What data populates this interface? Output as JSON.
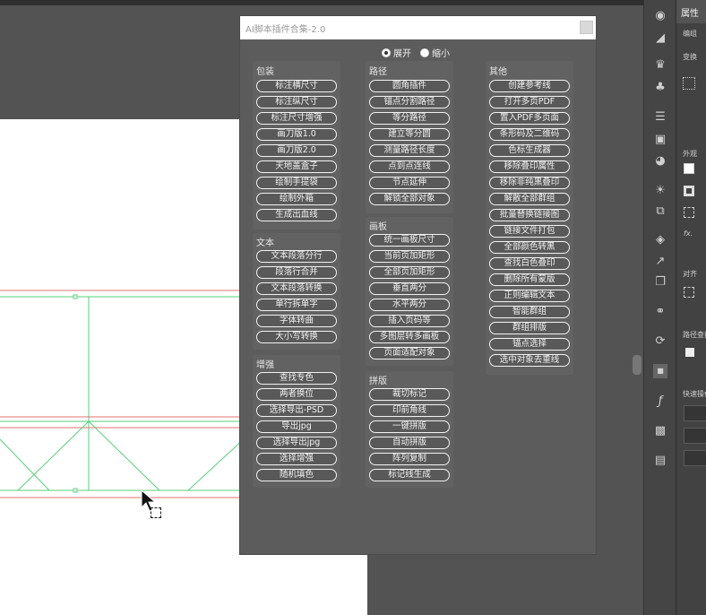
{
  "panel": {
    "title": "AI脚本插件合集-2.0",
    "mode_expand": "展开",
    "mode_collapse": "缩小",
    "groups": {
      "packaging": {
        "title": "包装",
        "buttons": [
          "标注横尺寸",
          "标注纵尺寸",
          "标注尺寸增强",
          "画刀版1.0",
          "画刀版2.0",
          "天地盖盒子",
          "绘制手提袋",
          "绘制外箱",
          "生成出血线"
        ]
      },
      "text": {
        "title": "文本",
        "buttons": [
          "文本段落分行",
          "段落行合并",
          "文本段落转换",
          "单行拆单字",
          "字体转曲",
          "大小写转换"
        ]
      },
      "enhance": {
        "title": "增强",
        "buttons": [
          "查找专色",
          "两者换位",
          "选择导出-PSD",
          "导出jpg",
          "选择导出jpg",
          "选择增强",
          "随机填色"
        ]
      },
      "path": {
        "title": "路径",
        "buttons": [
          "圆角插件",
          "锚点分割路径",
          "等分路径",
          "建立等分圆",
          "测量路径长度",
          "点到点连线",
          "节点延伸",
          "解锁全部对象"
        ]
      },
      "artboard": {
        "title": "画板",
        "buttons": [
          "统一画板尺寸",
          "当前页加矩形",
          "全部页加矩形",
          "垂直两分",
          "水平两分",
          "插入页码等",
          "多图层转多画板",
          "页面适配对象"
        ]
      },
      "imposition": {
        "title": "拼版",
        "buttons": [
          "裁切标记",
          "印前角线",
          "一键拼版",
          "自动拼版",
          "阵列复制",
          "标记线生成"
        ]
      },
      "other": {
        "title": "其他",
        "buttons": [
          "创建参考线",
          "打开多页PDF",
          "置入PDF多页面",
          "条形码及二维码",
          "色标生成器",
          "移除叠印属性",
          "移除非纯黑叠印",
          "解散全部群组",
          "批量替换链接图",
          "链接文件打包",
          "全部颜色转黑",
          "查找白色叠印",
          "删除所有蒙版",
          "正则编辑文本",
          "智能群组",
          "群组排版",
          "锚点选择",
          "选中对象去重线"
        ]
      }
    }
  },
  "properties": {
    "tab": "属性",
    "section_edit": "编组",
    "section_transform": "变换",
    "section_appearance": "外观",
    "section_align": "对齐",
    "section_pathfinder": "路径查找器",
    "section_quick": "快速操作",
    "fx_label": "fx."
  },
  "tools": [
    "color-theme-icon",
    "rect-gradient-icon",
    "puppet-icon",
    "club-symbol-icon",
    "stroke-lines-icon",
    "gradient-box-icon",
    "transparency-icon",
    "sun-burst-icon",
    "transform-icon",
    "layers-icon",
    "export-icon",
    "artboards-icon",
    "links-icon",
    "rotate-icon",
    "gg-badge-icon",
    "font-icon",
    "swatch-icon",
    "doc-icon"
  ]
}
